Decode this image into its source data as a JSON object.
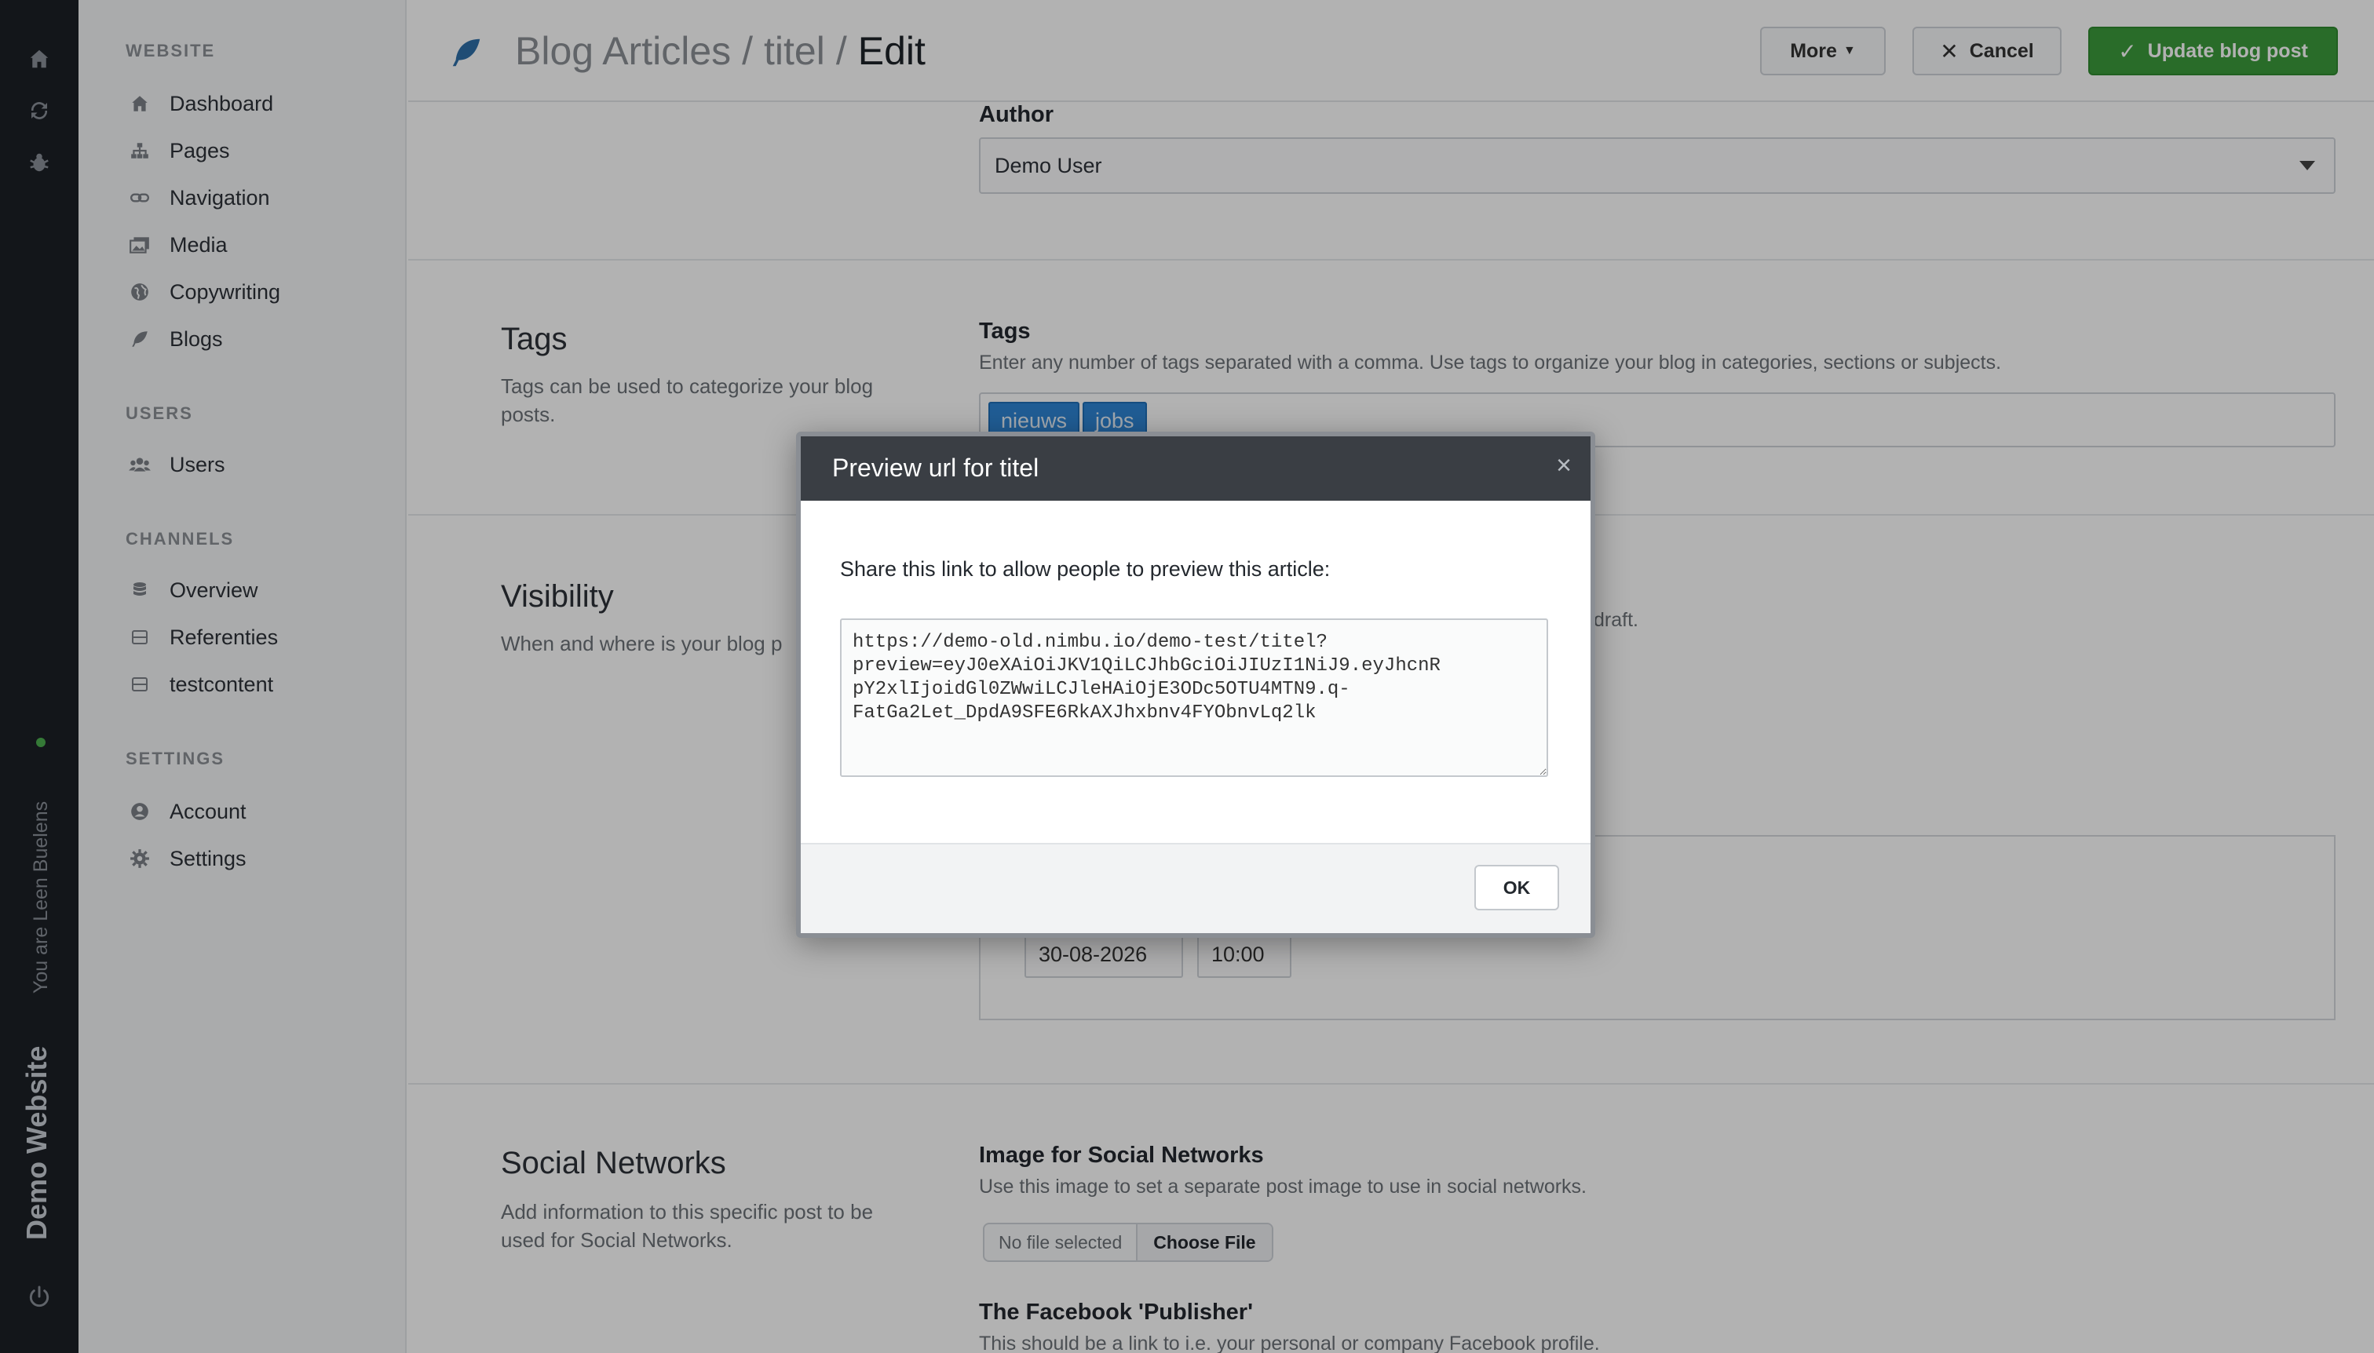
{
  "rail": {
    "icons": [
      "home-icon",
      "refresh-icon",
      "bug-icon",
      "power-icon"
    ],
    "user_text": "You are Leen Buelens",
    "site_name": "Demo Website"
  },
  "sidebar": {
    "sections": [
      {
        "heading": "WEBSITE",
        "items": [
          {
            "label": "Dashboard",
            "icon": "home-icon"
          },
          {
            "label": "Pages",
            "icon": "sitemap-icon"
          },
          {
            "label": "Navigation",
            "icon": "link-icon"
          },
          {
            "label": "Media",
            "icon": "images-icon"
          },
          {
            "label": "Copywriting",
            "icon": "globe-icon"
          },
          {
            "label": "Blogs",
            "icon": "feather-icon"
          }
        ]
      },
      {
        "heading": "USERS",
        "items": [
          {
            "label": "Users",
            "icon": "users-icon"
          }
        ]
      },
      {
        "heading": "CHANNELS",
        "items": [
          {
            "label": "Overview",
            "icon": "database-icon"
          },
          {
            "label": "Referenties",
            "icon": "table-icon"
          },
          {
            "label": "testcontent",
            "icon": "table-icon"
          }
        ]
      },
      {
        "heading": "SETTINGS",
        "items": [
          {
            "label": "Account",
            "icon": "user-circle-icon"
          },
          {
            "label": "Settings",
            "icon": "gear-icon"
          }
        ]
      }
    ]
  },
  "header": {
    "icon": "feather-icon",
    "breadcrumb": [
      "Blog Articles",
      "titel",
      "Edit"
    ],
    "separator": "/",
    "more_label": "More",
    "cancel_label": "Cancel",
    "update_label": "Update blog post"
  },
  "author": {
    "label": "Author",
    "value": "Demo User"
  },
  "tags_section": {
    "title": "Tags",
    "description": "Tags can be used to categorize your blog posts.",
    "field_label": "Tags",
    "help": "Enter any number of tags separated with a comma. Use tags to organize your blog in categories, sections or subjects.",
    "tags": [
      "nieuws",
      "jobs"
    ]
  },
  "visibility_section": {
    "title": "Visibility",
    "description": "When and where is your blog p",
    "help_tail": "draft.",
    "date": "30-08-2026",
    "time": "10:00"
  },
  "social_section": {
    "title": "Social Networks",
    "description": "Add information to this specific post to be used for Social Networks.",
    "image_label": "Image for Social Networks",
    "image_help": "Use this image to set a separate post image to use in social networks.",
    "no_file": "No file selected",
    "choose_file": "Choose File",
    "publisher_label": "The Facebook 'Publisher'",
    "publisher_help": "This should be a link to i.e. your personal or company Facebook profile."
  },
  "modal": {
    "title": "Preview url for titel",
    "close_glyph": "×",
    "message": "Share this link to allow people to preview this article:",
    "url": "https://demo-old.nimbu.io/demo-test/titel?\npreview=eyJ0eXAiOiJKV1QiLCJhbGciOiJIUzI1NiJ9.eyJhcnR\npY2xlIjoidGl0ZWwiLCJleHAiOjE3ODc5OTU4MTN9.q-\nFatGa2Let_DpdA9SFE6RkAXJhxbnv4FYObnvLq2lk",
    "ok_label": "OK"
  }
}
